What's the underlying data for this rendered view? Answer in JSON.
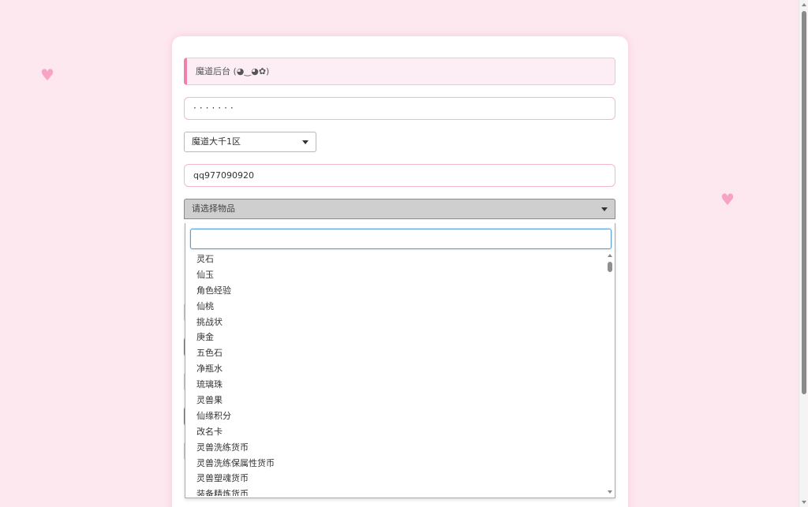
{
  "decor": {
    "heart_glyph": "♥"
  },
  "form": {
    "title": "魔道后台 (◕‿◕✿)",
    "password_value": "·······",
    "server_select": {
      "selected": "魔道大千1区"
    },
    "account_value": "qq977090920",
    "item_select": {
      "placeholder": "请选择物品"
    }
  },
  "dropdown": {
    "search_value": "",
    "options": [
      "灵石",
      "仙玉",
      "角色经验",
      "仙桃",
      "挑战状",
      "庚金",
      "五色石",
      "净瓶水",
      "琉璃珠",
      "灵兽果",
      "仙缘积分",
      "改名卡",
      "灵兽洗练货币",
      "灵兽洗练保属性货币",
      "灵兽塑魂货币",
      "装备精炼货币"
    ]
  },
  "colors": {
    "background": "#fde8f0",
    "accent_pink": "#ef80ad",
    "heart": "#f7a3c4",
    "focus_blue": "#5b9dd9"
  }
}
